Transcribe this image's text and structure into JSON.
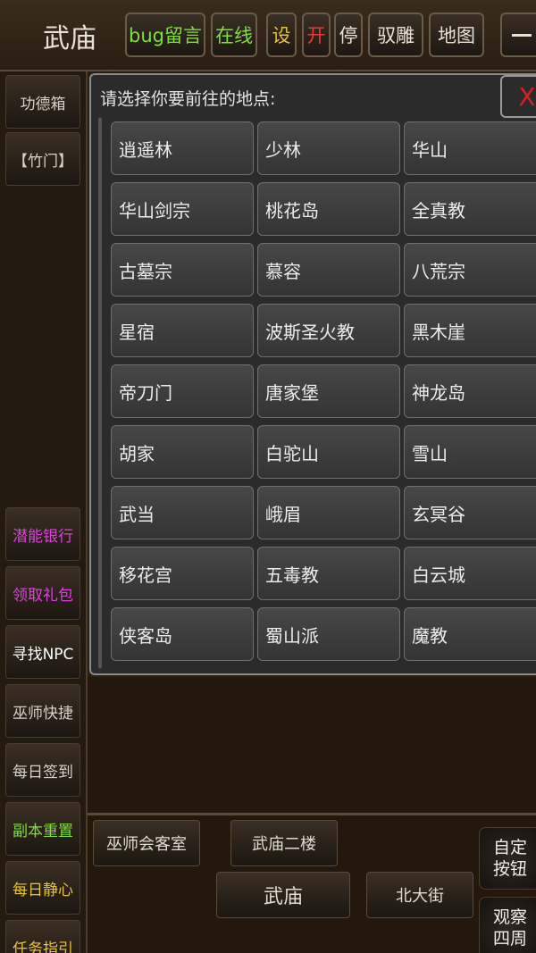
{
  "header": {
    "title": "武庙",
    "buttons": [
      {
        "id": "bug",
        "label": "bug留言",
        "color": "#7ee03a"
      },
      {
        "id": "online",
        "label": "在线",
        "color": "#7ee03a"
      },
      {
        "id": "settings",
        "label": "设",
        "color": "#e8c43a"
      },
      {
        "id": "open",
        "label": "开",
        "color": "#e83a3a"
      },
      {
        "id": "stop",
        "label": "停",
        "color": "#e8e2d6"
      },
      {
        "id": "tame",
        "label": "驭雕",
        "color": "#e8e2d6"
      },
      {
        "id": "map",
        "label": "地图",
        "color": "#e8e2d6"
      }
    ]
  },
  "sidebar": {
    "items": [
      {
        "label": "功德箱",
        "color": "#d8d2c6"
      },
      {
        "label": "【竹门】",
        "color": "#d8d2c6"
      },
      {
        "label": "潜能银行",
        "color": "#e040e0"
      },
      {
        "label": "领取礼包",
        "color": "#e040e0"
      },
      {
        "label": "寻找NPC",
        "color": "#ffffff"
      },
      {
        "label": "巫师快捷",
        "color": "#d8d2c6"
      },
      {
        "label": "每日签到",
        "color": "#d8d2c6"
      },
      {
        "label": "副本重置",
        "color": "#7ee03a"
      },
      {
        "label": "每日静心",
        "color": "#e8c43a"
      },
      {
        "label": "任务指引",
        "color": "#e8c43a"
      }
    ]
  },
  "dialog": {
    "title": "请选择你要前往的地点:",
    "close_label": "X",
    "locations": [
      "逍遥林",
      "少林",
      "华山",
      "华山剑宗",
      "桃花岛",
      "全真教",
      "古墓宗",
      "慕容",
      "八荒宗",
      "星宿",
      "波斯圣火教",
      "黑木崖",
      "帝刀门",
      "唐家堡",
      "神龙岛",
      "胡家",
      "白驼山",
      "雪山",
      "武当",
      "峨眉",
      "玄冥谷",
      "移花宫",
      "五毒教",
      "白云城",
      "侠客岛",
      "蜀山派",
      "魔教"
    ]
  },
  "rooms": {
    "wizard_room": "巫师会客室",
    "temple_floor2": "武庙二楼",
    "current": "武庙",
    "north_street": "北大街"
  },
  "right_buttons": {
    "custom": "自定\n按钮",
    "observe": "观察\n四周"
  }
}
